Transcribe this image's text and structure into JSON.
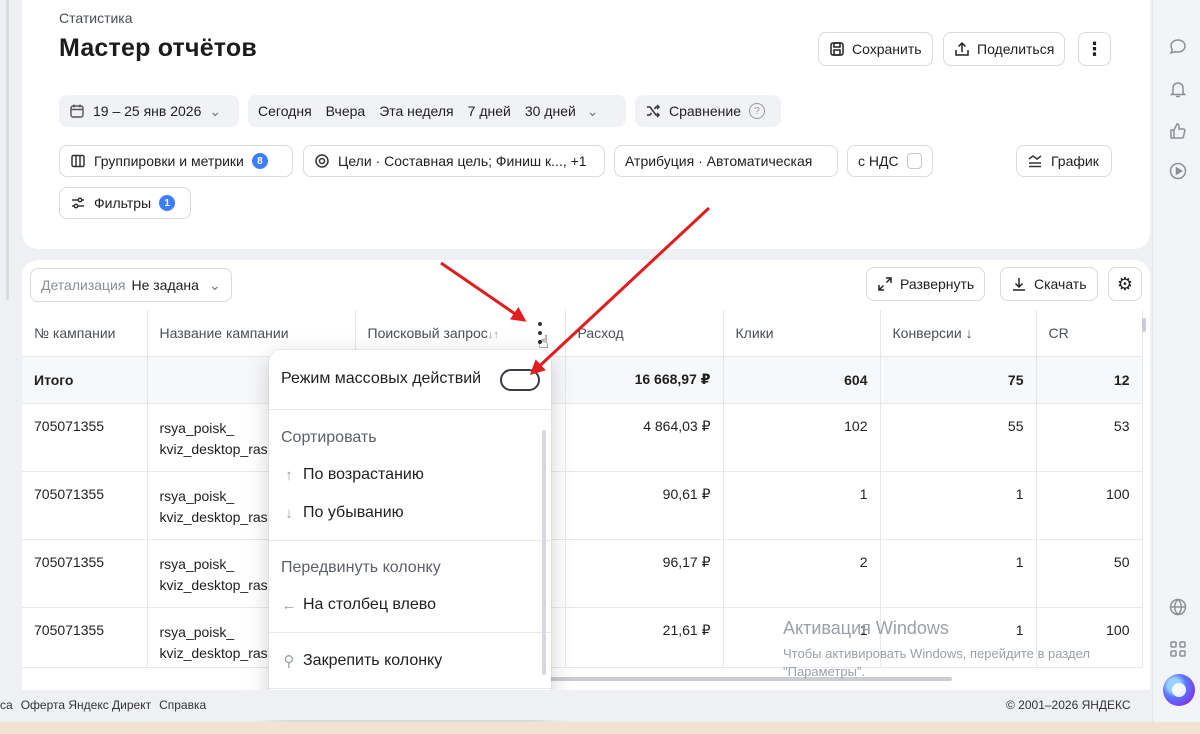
{
  "breadcrumb": "Статистика",
  "page_title": "Мастер отчётов",
  "header_buttons": {
    "save": "Сохранить",
    "share": "Поделиться"
  },
  "date_range": "19 – 25 янв 2026",
  "quick_periods": [
    "Сегодня",
    "Вчера",
    "Эта неделя",
    "7 дней",
    "30 дней"
  ],
  "compare": "Сравнение",
  "groupings": {
    "label": "Группировки и метрики",
    "count": "8"
  },
  "goals": "Цели · Составная цель; Финиш к..., +1",
  "attribution": "Атрибуция · Автоматическая",
  "vat": "с НДС",
  "chart_button": "График",
  "filters": {
    "label": "Фильтры",
    "count": "1"
  },
  "detail": {
    "label": "Детализация",
    "value": "Не задана"
  },
  "table_buttons": {
    "expand": "Развернуть",
    "download": "Скачать"
  },
  "columns": [
    "№ кампании",
    "Название кампании",
    "Поисковый запрос",
    "Расход",
    "Клики",
    "Конверсии",
    "CR"
  ],
  "total_row": {
    "label": "Итого",
    "spend": "16 668,97 ₽",
    "clicks": "604",
    "conversions": "75",
    "cr": "12"
  },
  "rows": [
    {
      "id": "705071355",
      "name1": "rsya_poisk_",
      "name2": "kviz_desktop_ras",
      "spend": "4 864,03 ₽",
      "clicks": "102",
      "conversions": "55",
      "cr": "53"
    },
    {
      "id": "705071355",
      "name1": "rsya_poisk_",
      "name2": "kviz_desktop_ras",
      "spend": "90,61 ₽",
      "clicks": "1",
      "conversions": "1",
      "cr": "100"
    },
    {
      "id": "705071355",
      "name1": "rsya_poisk_",
      "name2": "kviz_desktop_ras",
      "spend": "96,17 ₽",
      "clicks": "2",
      "conversions": "1",
      "cr": "50"
    },
    {
      "id": "705071355",
      "name1": "rsya_poisk_",
      "name2": "kviz_desktop_ras",
      "spend": "21,61 ₽",
      "clicks": "1",
      "conversions": "1",
      "cr": "100"
    }
  ],
  "menu": {
    "mass_mode": "Режим массовых действий",
    "sort_section": "Сортировать",
    "sort_asc": "По возрастанию",
    "sort_desc": "По убыванию",
    "move_section": "Передвинуть колонку",
    "move_left": "На столбец влево",
    "pin": "Закрепить колонку"
  },
  "footer": {
    "links": [
      "са",
      "Оферта Яндекс Директ",
      "Справка"
    ],
    "copyright": "© 2001–2026 ЯНДЕКС"
  },
  "watermark": {
    "title": "Активация Windows",
    "line1": "Чтобы активировать Windows, перейдите в раздел",
    "line2": "\"Параметры\"."
  },
  "colors": {
    "accent": "#3d7dff",
    "arrow": "#e11d1d"
  }
}
